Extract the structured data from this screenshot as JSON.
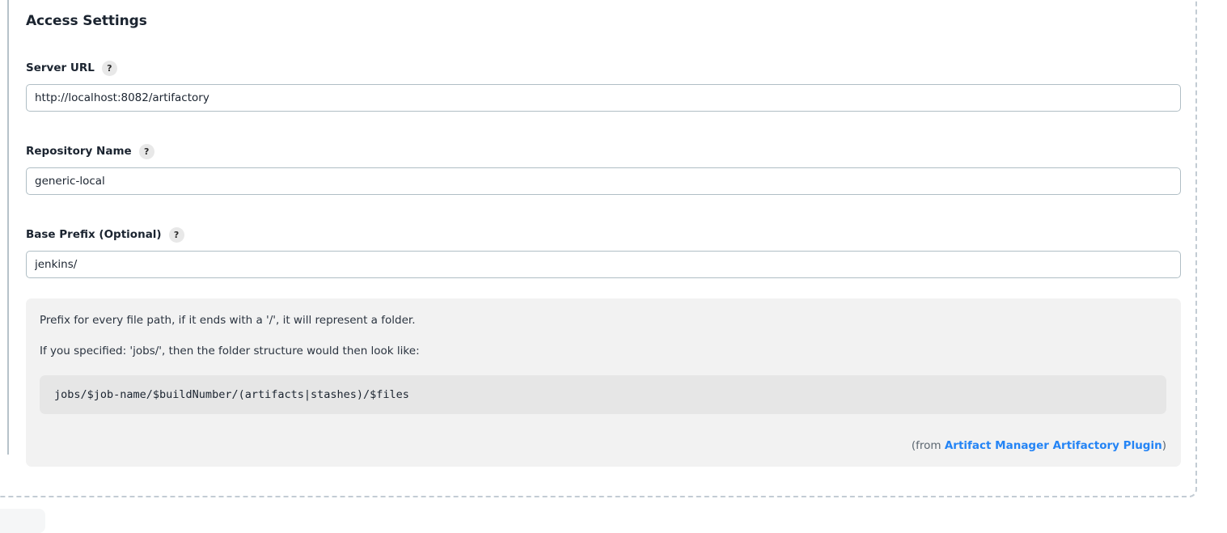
{
  "section": {
    "title": "Access Settings",
    "fields": [
      {
        "label": "Server URL",
        "help_icon": "question-mark-icon",
        "value": "http://localhost:8082/artifactory",
        "placeholder": ""
      },
      {
        "label": "Repository Name",
        "help_icon": "question-mark-icon",
        "value": "generic-local",
        "placeholder": ""
      },
      {
        "label": "Base Prefix (Optional)",
        "help_icon": "question-mark-icon",
        "value": "jenkins/",
        "placeholder": ""
      }
    ]
  },
  "help_panel": {
    "paragraph_1": "Prefix for every file path, if it ends with a '/', it will represent a folder.",
    "paragraph_2": "If you specified: 'jobs/', then the folder structure would then look like:",
    "code_example": "jobs/$job-name/$buildNumber/(artifacts|stashes)/$files",
    "footer_prefix": "(from ",
    "footer_link": "Artifact Manager Artifactory Plugin",
    "footer_suffix": ")"
  },
  "colors": {
    "link": "#2484f5",
    "panel_background": "#f2f2f2",
    "code_background": "#e6e6e6",
    "input_border": "#b0bec5",
    "section_rule": "#b6c2ca",
    "dashed_border": "#c3ccd4",
    "text": "#1b2430"
  }
}
